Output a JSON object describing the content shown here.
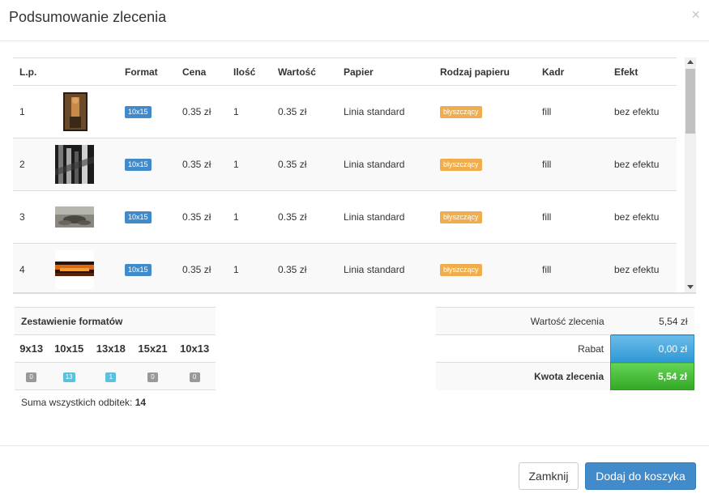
{
  "modal": {
    "title": "Podsumowanie zlecenia",
    "close_symbol": "×"
  },
  "items_table": {
    "headers": [
      "L.p.",
      "",
      "Format",
      "Cena",
      "Ilość",
      "Wartość",
      "Papier",
      "Rodzaj papieru",
      "Kadr",
      "Efekt"
    ],
    "rows": [
      {
        "lp": "1",
        "format": "10x15",
        "cena": "0.35 zł",
        "ilosc": "1",
        "wartosc": "0.35 zł",
        "papier": "Linia standard",
        "rodzaj": "błyszczący",
        "kadr": "fill",
        "efekt": "bez efektu"
      },
      {
        "lp": "2",
        "format": "10x15",
        "cena": "0.35 zł",
        "ilosc": "1",
        "wartosc": "0.35 zł",
        "papier": "Linia standard",
        "rodzaj": "błyszczący",
        "kadr": "fill",
        "efekt": "bez efektu"
      },
      {
        "lp": "3",
        "format": "10x15",
        "cena": "0.35 zł",
        "ilosc": "1",
        "wartosc": "0.35 zł",
        "papier": "Linia standard",
        "rodzaj": "błyszczący",
        "kadr": "fill",
        "efekt": "bez efektu"
      },
      {
        "lp": "4",
        "format": "10x15",
        "cena": "0.35 zł",
        "ilosc": "1",
        "wartosc": "0.35 zł",
        "papier": "Linia standard",
        "rodzaj": "błyszczący",
        "kadr": "fill",
        "efekt": "bez efektu"
      }
    ]
  },
  "formats_summary": {
    "title": "Zestawienie formatów",
    "formats": [
      "9x13",
      "10x15",
      "13x18",
      "15x21",
      "10x13"
    ],
    "counts": [
      "0",
      "13",
      "1",
      "0",
      "0"
    ],
    "total_label": "Suma wszystkich odbitek:",
    "total_value": "14"
  },
  "order_summary": {
    "order_value_label": "Wartość zlecenia",
    "order_value": "5,54 zł",
    "discount_label": "Rabat",
    "discount_value": "0,00 zł",
    "total_label": "Kwota zlecenia",
    "total_value": "5,54 zł"
  },
  "footer": {
    "close_label": "Zamknij",
    "add_label": "Dodaj do koszyka"
  },
  "colors": {
    "primary": "#428bca",
    "format_badge": "#428bca",
    "paper_badge": "#f0ad4e",
    "discount": "#3aa0dc",
    "total": "#4cc43c"
  }
}
